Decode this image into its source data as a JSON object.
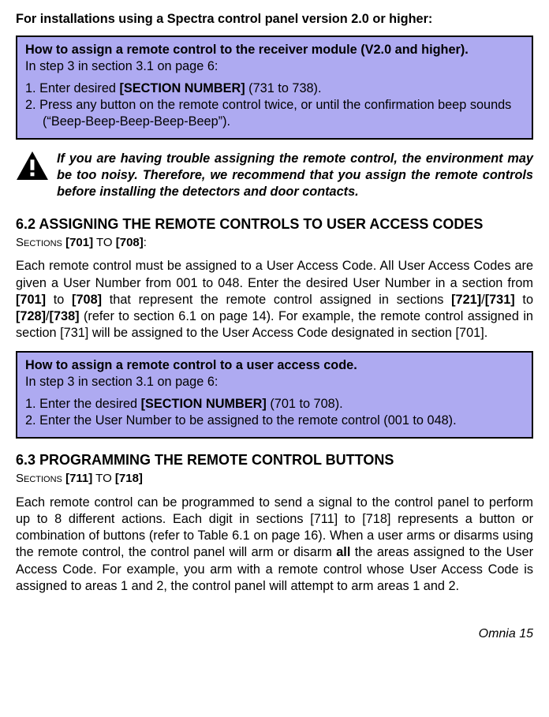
{
  "intro": "For installations using a Spectra control panel version 2.0 or higher:",
  "box1": {
    "title": "How to assign a remote control to the receiver module (V2.0 and higher).",
    "subtitle": "In step 3 in section 3.1 on page 6:",
    "item1_pre": "1. Enter desired ",
    "item1_sec": "[SECTION NUMBER]",
    "item1_post": " (731 to 738).",
    "item2": "2. Press any button on the remote control twice, or until the confirmation beep sounds (“Beep-Beep-Beep-Beep-Beep”)."
  },
  "warning": "If you are having trouble assigning the remote control, the environment may be too noisy. Therefore, we recommend that you assign the remote controls before installing the detectors and door contacts.",
  "sec62": {
    "heading": "6.2 ASSIGNING THE REMOTE CONTROLS TO USER ACCESS CODES",
    "range_label": "Sections ",
    "range_a": "[701]",
    "range_to": " TO ",
    "range_b": "[708]",
    "range_colon": ":",
    "para_a": "Each remote control must be assigned to a User Access Code. All User Access Codes are given a User Number from 001 to 048. Enter the desired User Number in a section from ",
    "b701": "[701]",
    "para_b": " to ",
    "b708": "[708]",
    "para_c": " that represent the remote control assigned in sections ",
    "b721": "[721]",
    "slash": "/",
    "b731": "[731]",
    "para_d": " to ",
    "b728": "[728]",
    "b738": "[738]",
    "para_e": " (refer to section 6.1 on page 14). For example, the remote control assigned in section [731] will be assigned to the User Access Code designated in section [701]."
  },
  "box2": {
    "title": "How to assign a remote control to a user access code.",
    "subtitle": "In step 3 in section 3.1 on page 6:",
    "item1_pre": "1. Enter the desired ",
    "item1_sec": "[SECTION NUMBER]",
    "item1_post": " (701 to 708).",
    "item2": "2. Enter the User Number to be assigned to the remote control (001 to 048)."
  },
  "sec63": {
    "heading": "6.3 PROGRAMMING THE REMOTE CONTROL BUTTONS",
    "range_label": "Sections ",
    "range_a": "[711]",
    "range_to": " TO ",
    "range_b": "[718]",
    "para_a": "Each remote control can be programmed to send a signal to the control panel to perform up to 8 different actions. Each digit in sections [711] to [718] represents a button or combination of buttons (refer to Table 6.1 on page 16). When a user arms or disarms using the remote control, the control panel will arm or disarm ",
    "all": "all",
    "para_b": " the areas assigned to the User Access Code. For example, you arm with a remote control whose User Access Code is assigned to areas 1 and 2, the control panel will attempt to arm areas 1 and 2."
  },
  "footer": "Omnia 15"
}
